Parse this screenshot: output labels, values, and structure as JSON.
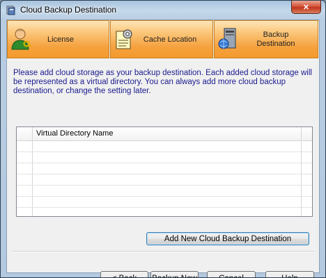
{
  "window": {
    "title": "Cloud Backup Destination",
    "close_glyph": "✕"
  },
  "steps": [
    {
      "label": "License",
      "icon": "user-key-icon"
    },
    {
      "label": "Cache Location",
      "icon": "settings-document-icon"
    },
    {
      "label_line1": "Backup",
      "label_line2": "Destination",
      "icon": "server-globe-icon"
    }
  ],
  "main": {
    "description": "Please add cloud storage as your backup destination. Each added cloud storage will be represented as a virtual directory. You can always add more cloud backup destination, or change the setting later.",
    "table": {
      "columns": [
        "Virtual Directory Name"
      ],
      "rows": []
    },
    "add_button": "Add New Cloud Backup Destination"
  },
  "footer": {
    "back_prefix": "< ",
    "back_mnemonic": "B",
    "back_rest": "ack",
    "backup_now": "Backup Now",
    "cancel": "Cancel",
    "help": "Help"
  },
  "colors": {
    "step_orange": "#f5a23f",
    "step_border": "#c8801f",
    "description_text": "#1a1a8f",
    "close_red": "#c2341b"
  }
}
